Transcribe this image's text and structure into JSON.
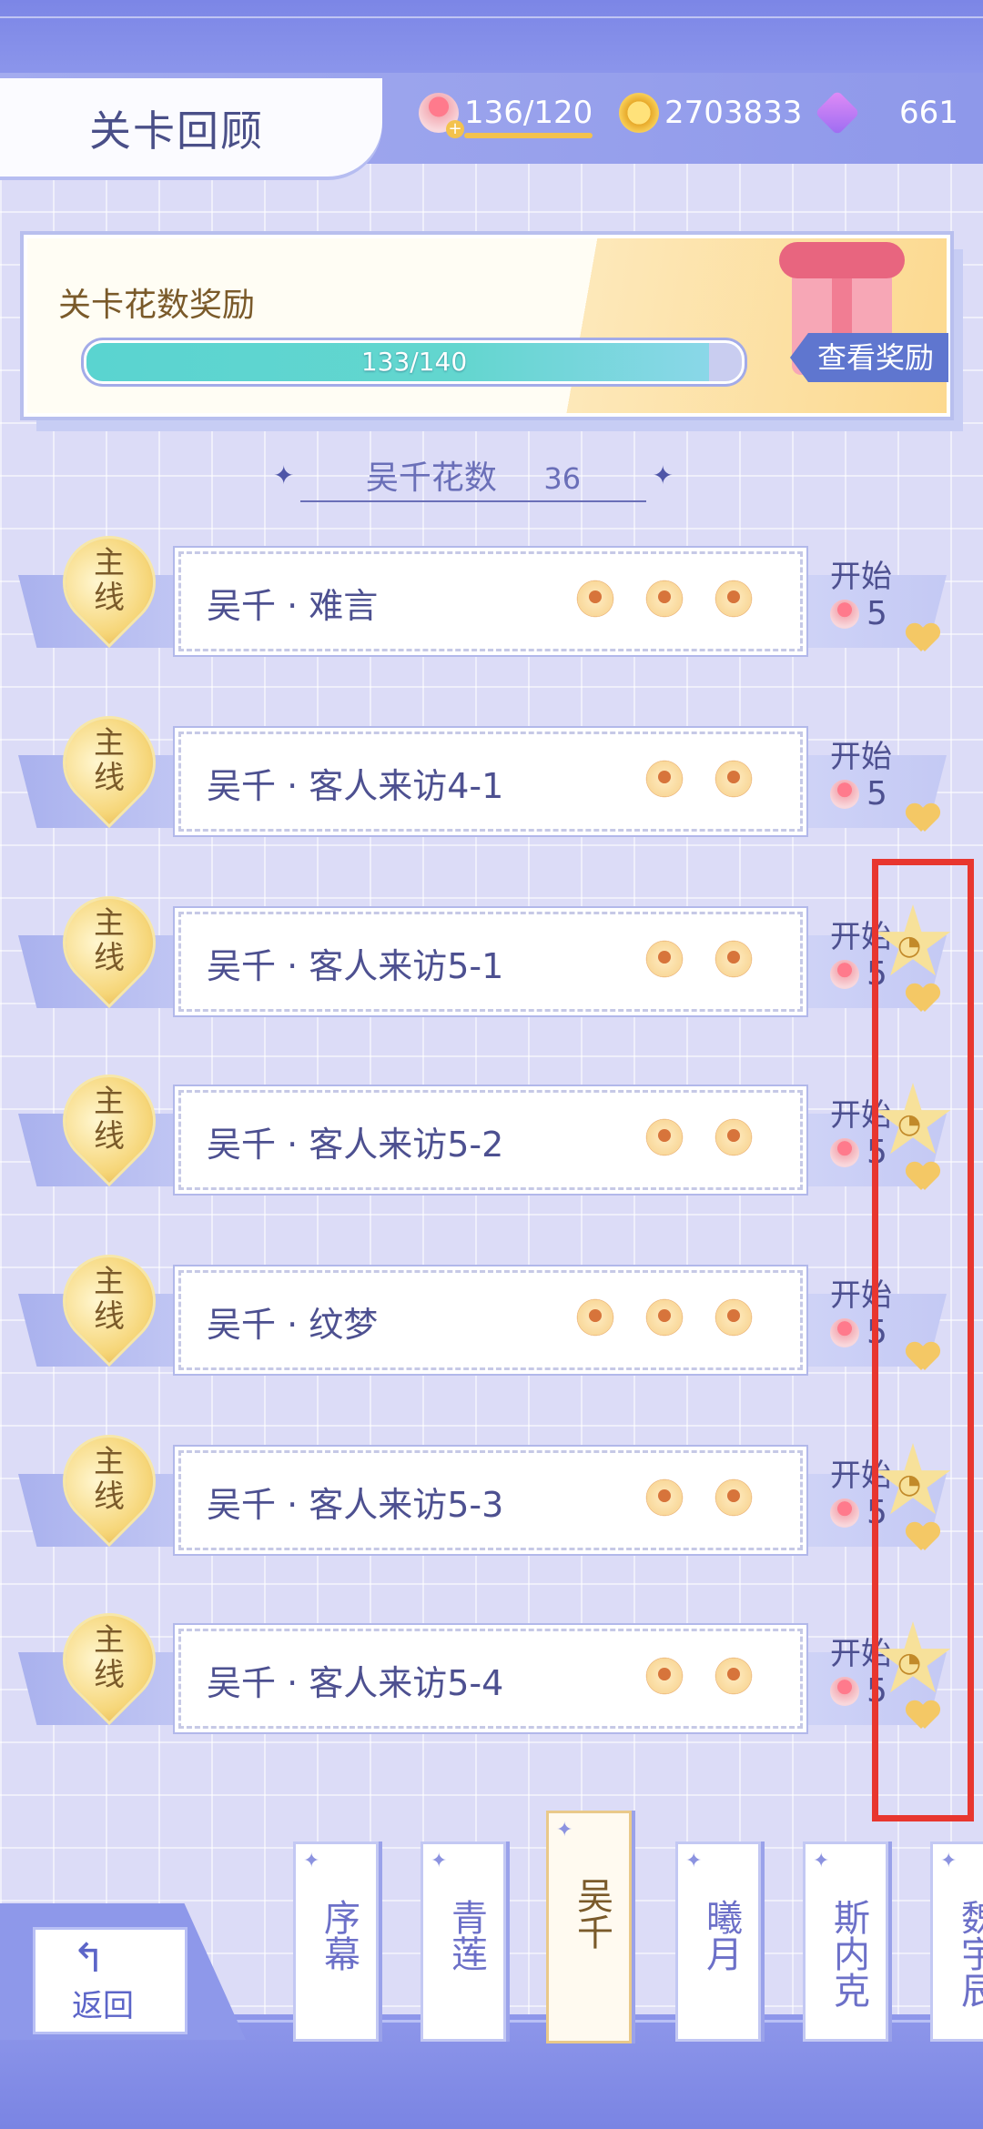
{
  "header": {
    "title": "关卡回顾",
    "stamina": "136/120",
    "coins": "2703833",
    "gems": "661"
  },
  "reward": {
    "title": "关卡花数奖励",
    "progress_text": "133/140",
    "progress_fraction": 0.95,
    "view_label": "查看奖励"
  },
  "section": {
    "title": "吴千花数",
    "count": "36"
  },
  "levels": [
    {
      "tag": "主线",
      "name": "吴千 · 难言",
      "flowers": 3,
      "start": "开始",
      "cost": "5",
      "star": false
    },
    {
      "tag": "主线",
      "name": "吴千 · 客人来访4-1",
      "flowers": 2,
      "start": "开始",
      "cost": "5",
      "star": false
    },
    {
      "tag": "主线",
      "name": "吴千 · 客人来访5-1",
      "flowers": 2,
      "start": "开始",
      "cost": "5",
      "star": true
    },
    {
      "tag": "主线",
      "name": "吴千 · 客人来访5-2",
      "flowers": 2,
      "start": "开始",
      "cost": "5",
      "star": true
    },
    {
      "tag": "主线",
      "name": "吴千 · 纹梦",
      "flowers": 3,
      "start": "开始",
      "cost": "5",
      "star": false
    },
    {
      "tag": "主线",
      "name": "吴千 · 客人来访5-3",
      "flowers": 2,
      "start": "开始",
      "cost": "5",
      "star": true
    },
    {
      "tag": "主线",
      "name": "吴千 · 客人来访5-4",
      "flowers": 2,
      "start": "开始",
      "cost": "5",
      "star": true
    }
  ],
  "bottom": {
    "back_label": "返回",
    "tabs": [
      "序幕",
      "青莲",
      "吴千",
      "曦月",
      "斯内克",
      "魏宇辰"
    ],
    "active_tab": 2
  },
  "colors": {
    "highlight_box": "#e8362f",
    "accent": "#5f76cf",
    "gold": "#f4c865"
  }
}
